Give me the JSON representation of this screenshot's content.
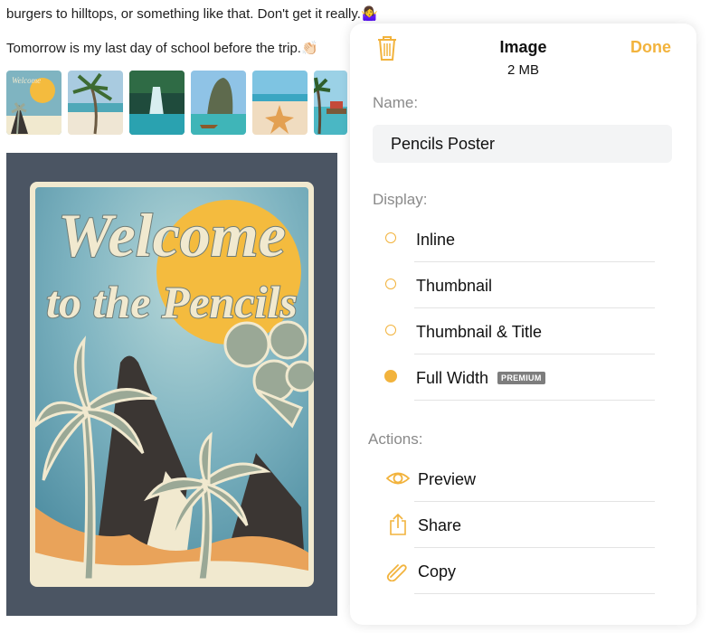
{
  "note": {
    "line1": "burgers to hilltops, or something like that. Don't get it really.",
    "line1_emoji": "🤷‍♀️",
    "line2": "Tomorrow is my last day of school before the trip.",
    "line2_emoji": "👏🏻"
  },
  "poster": {
    "line1": "Welcome",
    "line2": "to the Pencils"
  },
  "popover": {
    "title": "Image",
    "size": "2 MB",
    "done_label": "Done",
    "name_label": "Name:",
    "name_value": "Pencils Poster",
    "display_label": "Display:",
    "display_options": [
      {
        "label": "Inline",
        "selected": false
      },
      {
        "label": "Thumbnail",
        "selected": false
      },
      {
        "label": "Thumbnail & Title",
        "selected": false
      },
      {
        "label": "Full Width",
        "selected": true,
        "badge": "PREMIUM"
      }
    ],
    "actions_label": "Actions:",
    "actions": [
      {
        "label": "Preview",
        "icon": "eye-icon"
      },
      {
        "label": "Share",
        "icon": "share-icon"
      },
      {
        "label": "Copy",
        "icon": "paperclip-icon"
      }
    ]
  },
  "colors": {
    "accent": "#f2b33d",
    "image_frame": "#4b5563",
    "poster_sky": "#7fb4c1",
    "poster_sun": "#f4bb3e"
  }
}
